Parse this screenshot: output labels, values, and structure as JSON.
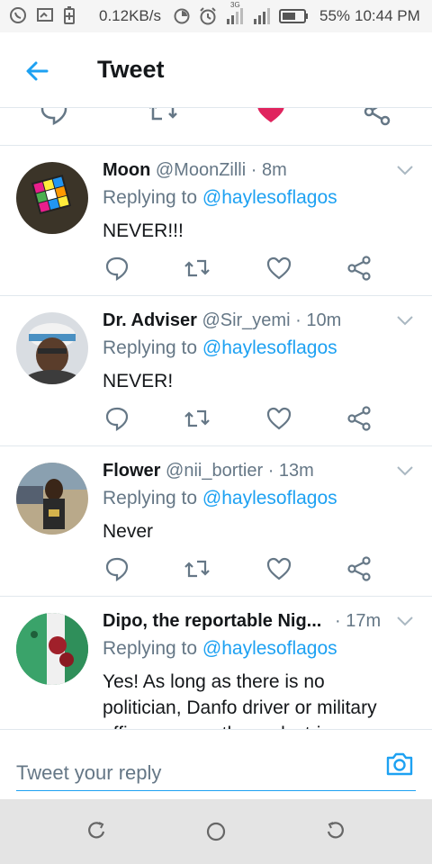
{
  "status_bar": {
    "speed": "0.12KB/s",
    "network": "3G",
    "battery": "55%",
    "time": "10:44 PM",
    "icons": [
      "whatsapp-icon",
      "screencast-icon",
      "battery-saver-icon",
      "data-saver-icon",
      "alarm-icon",
      "signal-icon",
      "signal-icon",
      "battery-icon"
    ]
  },
  "header": {
    "title": "Tweet",
    "back_icon": "arrow-left-icon"
  },
  "colors": {
    "accent": "#1da1f2",
    "like_active": "#e0245e",
    "secondary_text": "#657786"
  },
  "tweets": [
    {
      "name": "Moon",
      "handle": "@MoonZilli",
      "time": "· 8m",
      "reply_prefix": "Replying to ",
      "reply_to": "@haylesoflagos",
      "text": "NEVER!!!"
    },
    {
      "name": "Dr. Adviser",
      "handle": "@Sir_yemi",
      "time": "· 10m",
      "reply_prefix": "Replying to ",
      "reply_to": "@haylesoflagos",
      "text": "NEVER!"
    },
    {
      "name": "Flower",
      "handle": "@nii_bortier",
      "time": "· 13m",
      "reply_prefix": "Replying to ",
      "reply_to": "@haylesoflagos",
      "text": "Never"
    },
    {
      "name": "Dipo, the reportable Nig...",
      "handle": "",
      "time": "· 17m",
      "reply_prefix": "Replying to ",
      "reply_to": "@haylesoflagos",
      "text": "Yes! As long as there is no politician, Danfo driver or military officer among the pedestrians"
    }
  ],
  "reply_bar": {
    "placeholder": "Tweet your reply",
    "camera_icon": "camera-icon"
  },
  "nav_bar": {
    "icons": [
      "recents-icon",
      "home-icon",
      "back-icon"
    ]
  }
}
